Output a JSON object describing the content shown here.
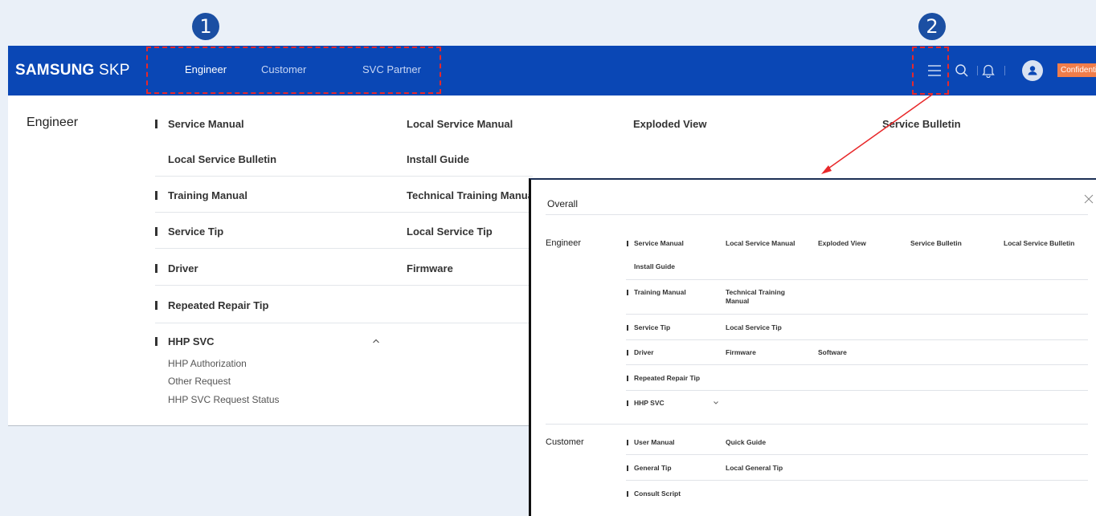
{
  "callouts": {
    "one": "1",
    "two": "2"
  },
  "header": {
    "logo_bold": "SAMSUNG",
    "logo_light": " SKP",
    "nav": [
      "Engineer",
      "Customer",
      "SVC Partner"
    ],
    "confidential": "Confidential"
  },
  "panel": {
    "section": "Engineer",
    "items": {
      "service_manual": "Service Manual",
      "local_service_manual": "Local Service Manual",
      "exploded_view": "Exploded View",
      "service_bulletin": "Service Bulletin",
      "local_service_bulletin": "Local Service Bulletin",
      "install_guide": "Install Guide",
      "training_manual": "Training Manual",
      "technical_training_manual": "Technical Training Manual",
      "service_tip": "Service Tip",
      "local_service_tip": "Local Service Tip",
      "driver": "Driver",
      "firmware": "Firmware",
      "repeated_repair_tip": "Repeated Repair Tip",
      "hhp_svc": "HHP SVC"
    },
    "hhp_sub": [
      "HHP Authorization",
      "Other Request",
      "HHP SVC Request Status"
    ]
  },
  "modal": {
    "title": "Overall",
    "engineer": {
      "label": "Engineer",
      "service_manual": "Service Manual",
      "local_service_manual": "Local Service Manual",
      "exploded_view": "Exploded View",
      "service_bulletin": "Service Bulletin",
      "local_service_bulletin": "Local Service Bulletin",
      "install_guide": "Install Guide",
      "training_manual": "Training Manual",
      "technical_training_manual": "Technical Training Manual",
      "service_tip": "Service Tip",
      "local_service_tip": "Local Service Tip",
      "driver": "Driver",
      "firmware": "Firmware",
      "software": "Software",
      "repeated_repair_tip": "Repeated Repair Tip",
      "hhp_svc": "HHP SVC"
    },
    "customer": {
      "label": "Customer",
      "user_manual": "User Manual",
      "quick_guide": "Quick Guide",
      "general_tip": "General Tip",
      "local_general_tip": "Local General Tip",
      "consult_script": "Consult Script"
    }
  },
  "colors": {
    "header_bg": "#0a47b5",
    "highlight": "#e8282a",
    "confidential_bg": "#f07d4a",
    "callout_bg": "#1b4fa3"
  }
}
